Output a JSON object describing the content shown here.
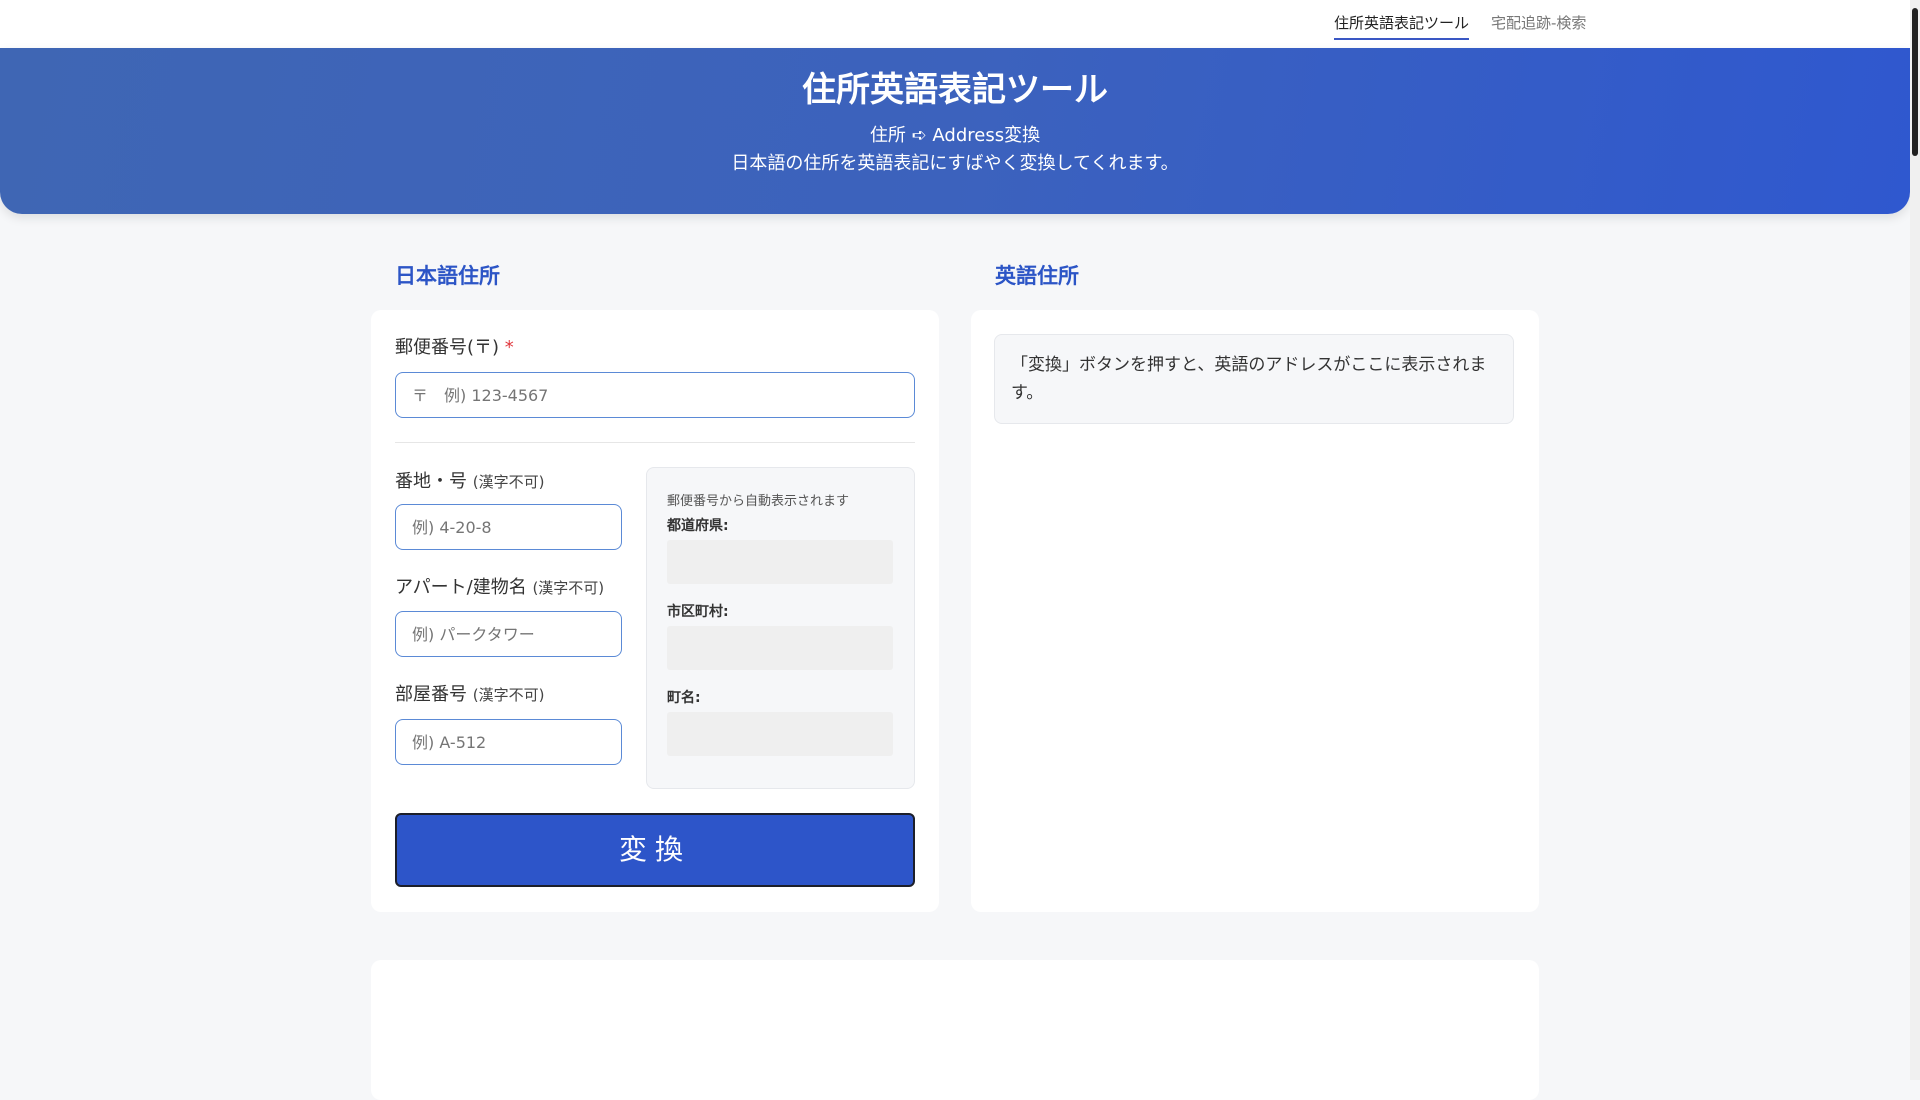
{
  "nav": {
    "tabs": [
      {
        "label": "住所英語表記ツール",
        "active": true
      },
      {
        "label": "宅配追跡-検索",
        "active": false
      }
    ]
  },
  "hero": {
    "title": "住所英語表記ツール",
    "subtitle": "住所 ➪ Address変換",
    "description": "日本語の住所を英語表記にすばやく変換してくれます。"
  },
  "japanese": {
    "heading": "日本語住所",
    "postal": {
      "label": "郵便番号(〒)",
      "required_mark": "*",
      "placeholder": "〒　例) 123-4567"
    },
    "street": {
      "label": "番地・号",
      "note": "(漢字不可)",
      "placeholder": "例) 4-20-8"
    },
    "building": {
      "label": "アパート/建物名",
      "note": "(漢字不可)",
      "placeholder": "例) パークタワー"
    },
    "room": {
      "label": "部屋番号",
      "note": "(漢字不可)",
      "placeholder": "例) A-512"
    },
    "auto": {
      "note": "郵便番号から自動表示されます",
      "prefecture_label": "都道府県:",
      "city_label": "市区町村:",
      "town_label": "町名:"
    },
    "convert_label": "変換"
  },
  "english": {
    "heading": "英語住所",
    "result_placeholder": "「変換」ボタンを押すと、英語のアドレスがここに表示されます。"
  },
  "colors": {
    "accent": "#2d55c9",
    "heading": "#2c55c6",
    "required": "#e0383e",
    "hero_gradient_start": "#3f66b4",
    "hero_gradient_end": "#2f58cf"
  }
}
